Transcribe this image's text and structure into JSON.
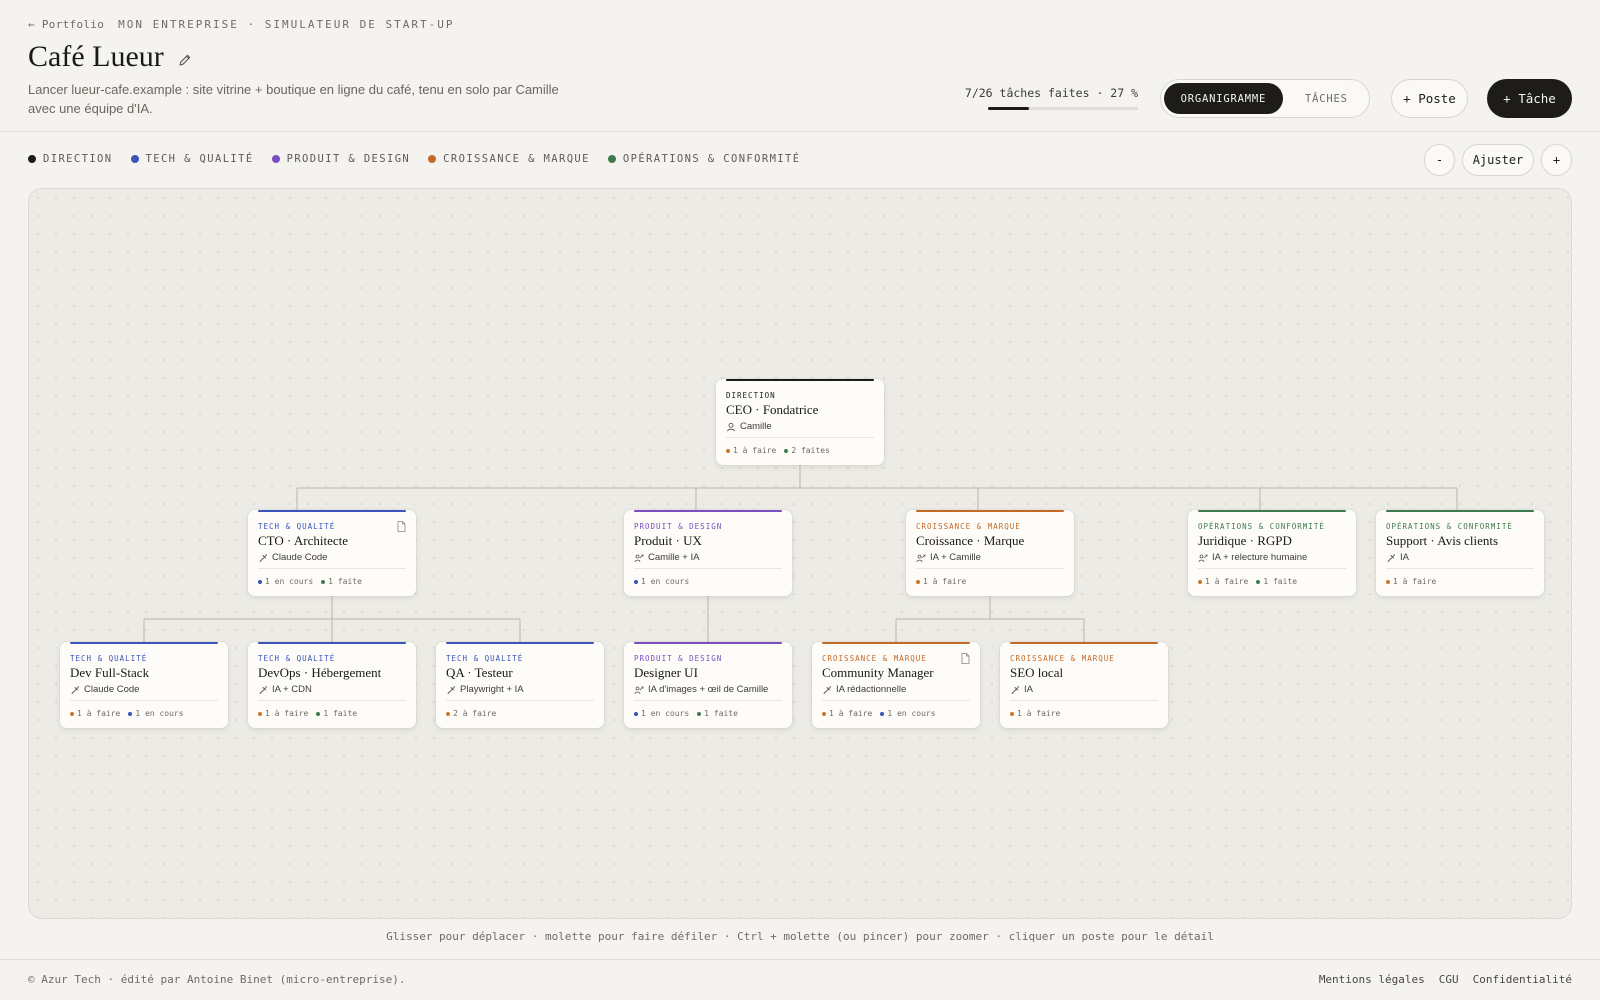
{
  "header": {
    "back_label": "← Portfolio",
    "section_label": "MON ENTREPRISE · SIMULATEUR DE START-UP",
    "title": "Café Lueur",
    "subtitle": "Lancer lueur-cafe.example : site vitrine + boutique en ligne du café, tenu en solo par Camille avec une équipe d'IA.",
    "progress_label": "7/26 tâches faites · 27 %",
    "progress_fraction": 0.27,
    "view_options": [
      "ORGANIGRAMME",
      "TÂCHES"
    ],
    "active_view": "ORGANIGRAMME",
    "add_role_label": "+ Poste",
    "add_task_label": "+ Tâche"
  },
  "legend": [
    {
      "label": "DIRECTION",
      "color": "#1d1c19"
    },
    {
      "label": "TECH & QUALITÉ",
      "color": "#3b54b8"
    },
    {
      "label": "PRODUIT & DESIGN",
      "color": "#7a4fc0"
    },
    {
      "label": "CROISSANCE & MARQUE",
      "color": "#c36a25"
    },
    {
      "label": "OPÉRATIONS & CONFORMITÉ",
      "color": "#3f7a4e"
    }
  ],
  "zoom": {
    "minus": "-",
    "fit": "Ajuster",
    "plus": "+"
  },
  "colors": {
    "todo": "#c8762a",
    "in_progress": "#3b54b8",
    "done": "#3f7a4e"
  },
  "org": {
    "ceo": {
      "dept": "DIRECTION",
      "role": "CEO · Fondatrice",
      "who": "Camille",
      "who_icon": "person-icon",
      "stats": [
        {
          "label": "1 à faire",
          "kind": "todo"
        },
        {
          "label": "2 faites",
          "kind": "done"
        }
      ]
    },
    "cto": {
      "dept": "TECH & QUALITÉ",
      "role": "CTO · Architecte",
      "who": "Claude Code",
      "who_icon": "robot-icon",
      "stats": [
        {
          "label": "1 en cours",
          "kind": "in_progress"
        },
        {
          "label": "1 faite",
          "kind": "done"
        }
      ]
    },
    "produit": {
      "dept": "PRODUIT & DESIGN",
      "role": "Produit · UX",
      "who": "Camille + IA",
      "who_icon": "people-icon",
      "stats": [
        {
          "label": "1 en cours",
          "kind": "in_progress"
        }
      ]
    },
    "croissance": {
      "dept": "CROISSANCE & MARQUE",
      "role": "Croissance · Marque",
      "who": "IA + Camille",
      "who_icon": "people-icon",
      "stats": [
        {
          "label": "1 à faire",
          "kind": "todo"
        }
      ]
    },
    "juridique": {
      "dept": "OPÉRATIONS & CONFORMITÉ",
      "role": "Juridique · RGPD",
      "who": "IA + relecture humaine",
      "who_icon": "people-icon",
      "stats": [
        {
          "label": "1 à faire",
          "kind": "todo"
        },
        {
          "label": "1 faite",
          "kind": "done"
        }
      ]
    },
    "support": {
      "dept": "OPÉRATIONS & CONFORMITÉ",
      "role": "Support · Avis clients",
      "who": "IA",
      "who_icon": "robot-icon",
      "stats": [
        {
          "label": "1 à faire",
          "kind": "todo"
        }
      ]
    },
    "devfs": {
      "dept": "TECH & QUALITÉ",
      "role": "Dev Full-Stack",
      "who": "Claude Code",
      "who_icon": "robot-icon",
      "stats": [
        {
          "label": "1 à faire",
          "kind": "todo"
        },
        {
          "label": "1 en cours",
          "kind": "in_progress"
        }
      ]
    },
    "devops": {
      "dept": "TECH & QUALITÉ",
      "role": "DevOps · Hébergement",
      "who": "IA + CDN",
      "who_icon": "robot-icon",
      "stats": [
        {
          "label": "1 à faire",
          "kind": "todo"
        },
        {
          "label": "1 faite",
          "kind": "done"
        }
      ]
    },
    "qa": {
      "dept": "TECH & QUALITÉ",
      "role": "QA · Testeur",
      "who": "Playwright + IA",
      "who_icon": "robot-icon",
      "stats": [
        {
          "label": "2 à faire",
          "kind": "todo"
        }
      ]
    },
    "designer": {
      "dept": "PRODUIT & DESIGN",
      "role": "Designer UI",
      "who": "IA d'images + œil de Camille",
      "who_icon": "people-icon",
      "stats": [
        {
          "label": "1 en cours",
          "kind": "in_progress"
        },
        {
          "label": "1 faite",
          "kind": "done"
        }
      ]
    },
    "community": {
      "dept": "CROISSANCE & MARQUE",
      "role": "Community Manager",
      "who": "IA rédactionnelle",
      "who_icon": "robot-icon",
      "stats": [
        {
          "label": "1 à faire",
          "kind": "todo"
        },
        {
          "label": "1 en cours",
          "kind": "in_progress"
        }
      ]
    },
    "seo": {
      "dept": "CROISSANCE & MARQUE",
      "role": "SEO local",
      "who": "IA",
      "who_icon": "robot-icon",
      "stats": [
        {
          "label": "1 à faire",
          "kind": "todo"
        }
      ]
    }
  },
  "hint": "Glisser pour déplacer · molette pour faire défiler · Ctrl + molette (ou pincer) pour zoomer · cliquer un poste pour le détail",
  "footer": {
    "copyright": "© Azur Tech · édité par Antoine Binet (micro-entreprise).",
    "links": [
      "Mentions légales",
      "CGU",
      "Confidentialité"
    ]
  }
}
